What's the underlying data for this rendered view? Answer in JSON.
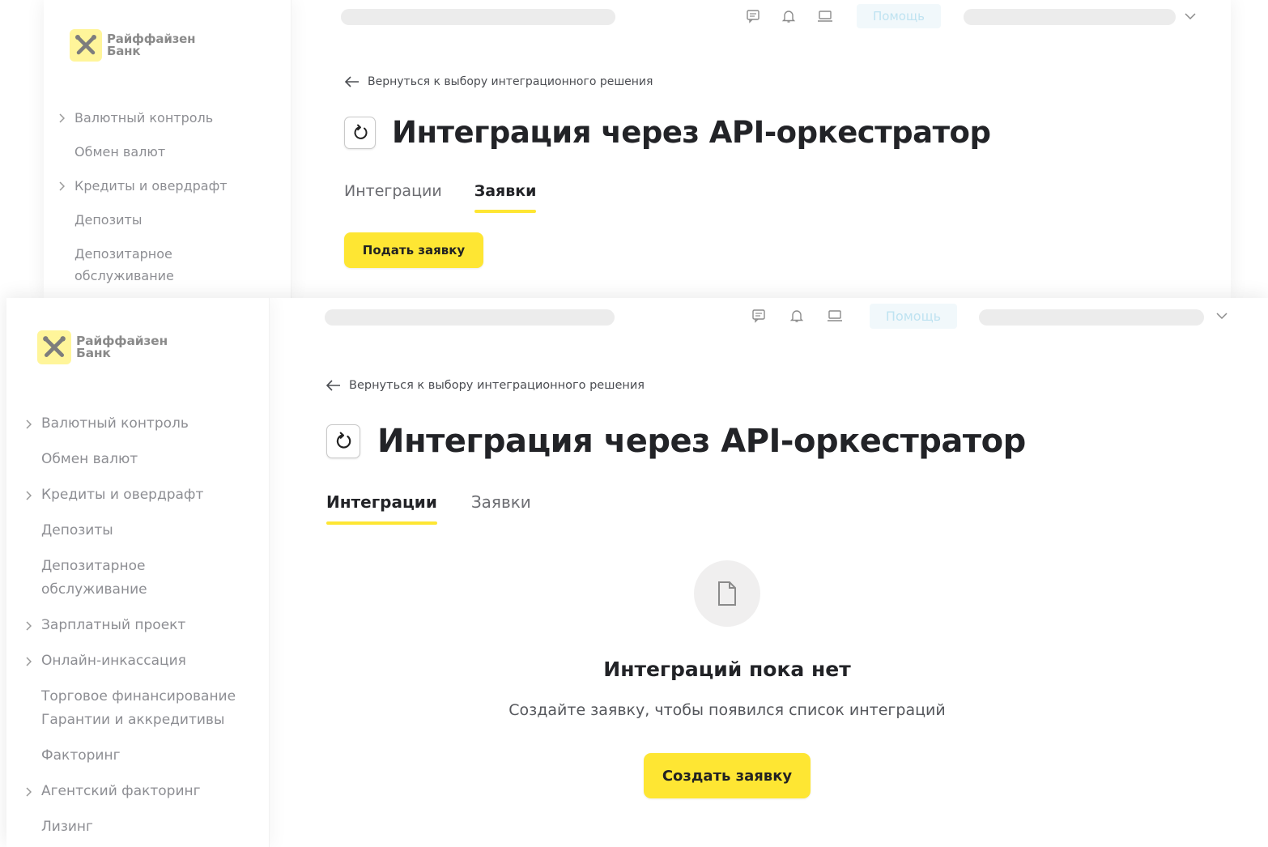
{
  "brand": {
    "line1": "Райффайзен",
    "line2": "Банк",
    "accent_color": "#fee633"
  },
  "top_screen": {
    "sidebar_items": [
      {
        "label": "Валютный контроль",
        "expandable": true
      },
      {
        "label": "Обмен валют",
        "expandable": false
      },
      {
        "label": "Кредиты и овердрафт",
        "expandable": true
      },
      {
        "label": "Депозиты",
        "expandable": false
      },
      {
        "label": "Депозитарное",
        "expandable": false
      },
      {
        "label": "обслуживание",
        "expandable": false
      }
    ],
    "header": {
      "help_label": "Помощь"
    },
    "back_label": "Вернуться к выбору интеграционного решения",
    "title": "Интеграция через API-оркестратор",
    "tabs": [
      {
        "label": "Интеграции",
        "active": false
      },
      {
        "label": "Заявки",
        "active": true
      }
    ],
    "submit_button": "Подать заявку"
  },
  "bottom_screen": {
    "sidebar_items": [
      {
        "label": "Валютный контроль",
        "expandable": true
      },
      {
        "label": "Обмен валют",
        "expandable": false
      },
      {
        "label": "Кредиты и овердрафт",
        "expandable": true
      },
      {
        "label": "Депозиты",
        "expandable": false
      },
      {
        "label": "Депозитарное",
        "expandable": false
      },
      {
        "label": "обслуживание",
        "expandable": false
      },
      {
        "label": "Зарплатный проект",
        "expandable": true
      },
      {
        "label": "Онлайн-инкассация",
        "expandable": true
      },
      {
        "label": "Торговое финансирование",
        "expandable": false
      },
      {
        "label": "Гарантии и аккредитивы",
        "expandable": false
      },
      {
        "label": "Факторинг",
        "expandable": false
      },
      {
        "label": "Агентский факторинг",
        "expandable": true
      },
      {
        "label": "Лизинг",
        "expandable": false
      }
    ],
    "header": {
      "help_label": "Помощь"
    },
    "back_label": "Вернуться к выбору интеграционного решения",
    "title": "Интеграция через API-оркестратор",
    "tabs": [
      {
        "label": "Интеграции",
        "active": true
      },
      {
        "label": "Заявки",
        "active": false
      }
    ],
    "empty_state": {
      "icon": "document-icon",
      "title": "Интеграций пока нет",
      "subtitle": "Создайте заявку, чтобы появился список интеграций",
      "button": "Создать заявку"
    }
  }
}
